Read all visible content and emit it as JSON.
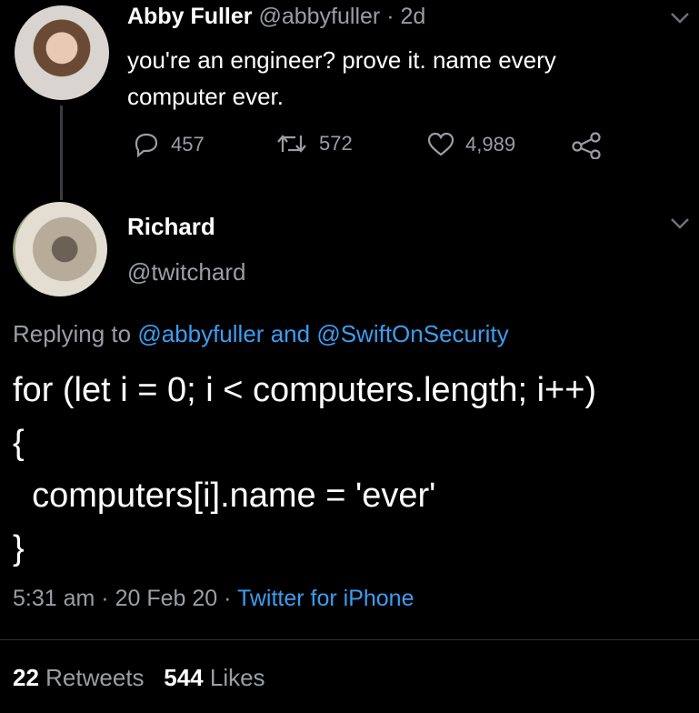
{
  "parent_tweet": {
    "name": "Abby Fuller",
    "handle": "@abbyfuller",
    "separator": "·",
    "time": "2d",
    "text": "you're an engineer? prove it. name every computer ever.",
    "actions": {
      "replies": "457",
      "retweets": "572",
      "likes": "4,989"
    }
  },
  "reply_tweet": {
    "name": "Richard",
    "handle": "@twitchard",
    "replying_prefix": "Replying to",
    "replying_user1": "@abbyfuller",
    "replying_and": "and",
    "replying_user2": "@SwiftOnSecurity",
    "code_lines": [
      "for (let i = 0; i < computers.length; i++)",
      "{",
      "  computers[i].name = 'ever'",
      "}"
    ],
    "time": "5:31 am",
    "sep1": "·",
    "date": "20 Feb 20",
    "sep2": "·",
    "source": "Twitter for iPhone",
    "stats": {
      "retweets_count": "22",
      "retweets_label": "Retweets",
      "likes_count": "544",
      "likes_label": "Likes"
    }
  },
  "colors": {
    "background": "#000000",
    "text": "#ffffff",
    "muted": "#9a9ea3",
    "link": "#3b9df2"
  },
  "icons": [
    "reply-icon",
    "retweet-icon",
    "like-icon",
    "share-icon",
    "chevron-down-icon"
  ]
}
